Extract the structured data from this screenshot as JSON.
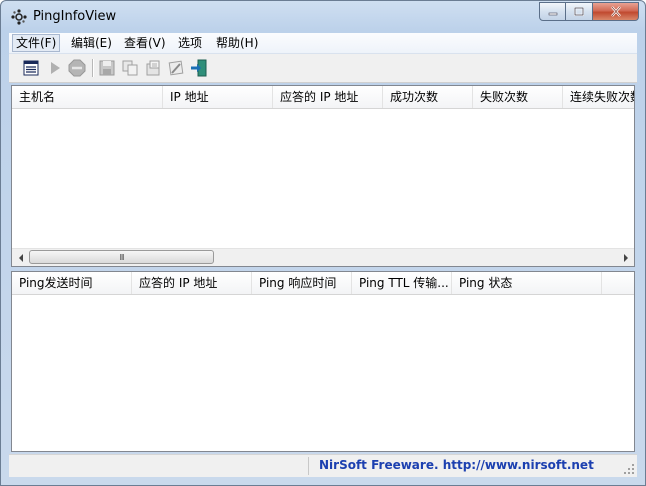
{
  "window": {
    "title": "PingInfoView"
  },
  "icons": {
    "app": "ping-app-icon",
    "minimize": "minimize-icon",
    "maximize": "maximize-icon",
    "close": "close-icon",
    "properties": "properties-icon",
    "start": "play-icon",
    "stop": "stop-icon",
    "save": "save-icon",
    "copy": "copy-icon",
    "html_report": "report-icon",
    "options": "options-icon",
    "exit": "exit-icon",
    "scroll_left": "arrow-left-icon",
    "scroll_right": "arrow-right-icon",
    "grip": "resize-grip-icon"
  },
  "menu": [
    {
      "label": "文件(F)",
      "active": true
    },
    {
      "label": "编辑(E)"
    },
    {
      "label": "查看(V)"
    },
    {
      "label": "选项"
    },
    {
      "label": "帮助(H)"
    }
  ],
  "top_table": {
    "columns": [
      "主机名",
      "IP 地址",
      "应答的 IP 地址",
      "成功次数",
      "失败次数",
      "连续失败次数"
    ],
    "rows": []
  },
  "scroll_grip": "III",
  "bottom_table": {
    "columns": [
      "Ping发送时间",
      "应答的 IP 地址",
      "Ping 响应时间",
      "Ping TTL 传输...",
      "Ping 状态"
    ],
    "rows": []
  },
  "status": {
    "link": "NirSoft Freeware.  http://www.nirsoft.net"
  },
  "colors": {
    "link": "#1c40b0",
    "stop_red": "#c0392b",
    "play_green": "#2e9a3a"
  }
}
